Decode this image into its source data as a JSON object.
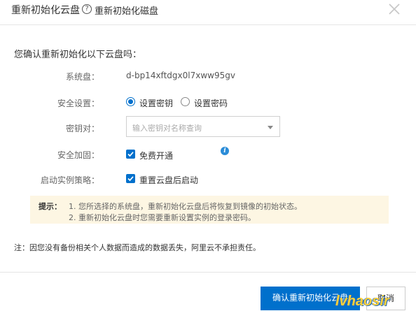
{
  "header": {
    "title": "重新初始化云盘",
    "help_glyph": "?",
    "subtitle": "重新初始化磁盘",
    "close_icon": "close-icon"
  },
  "form": {
    "question": "您确认重新初始化以下云盘吗：",
    "system_disk": {
      "label": "系统盘：",
      "value": "d-bp14xftdgx0l7xww95gv"
    },
    "security": {
      "label": "安全设置：",
      "options": [
        {
          "label": "设置密钥",
          "selected": true
        },
        {
          "label": "设置密码",
          "selected": false
        }
      ]
    },
    "key_pair": {
      "label": "密钥对：",
      "placeholder": "输入密钥对名称查询"
    },
    "hardening": {
      "label": "安全加固：",
      "checkbox_label": "免费开通",
      "checked": true,
      "info_icon": "info-icon"
    },
    "start_policy": {
      "label": "启动实例策略：",
      "checkbox_label": "重置云盘后启动",
      "checked": true
    }
  },
  "tip": {
    "label": "提示：",
    "lines": [
      "1. 您所选择的系统盘，重新初始化云盘后将恢复到镜像的初始状态。",
      "2. 重新初始化云盘时您需要重新设置实例的登录密码。"
    ]
  },
  "note": "注：因您没有备份相关个人数据而造成的数据丢失，阿里云不承担责任。",
  "footer": {
    "confirm_label": "确认重新初始化云盘",
    "cancel_label": "取消"
  },
  "watermark": "lvhaosir",
  "colors": {
    "accent": "#0070cc",
    "tip_bg": "#fdf6e3",
    "border": "#e5e5e5"
  }
}
